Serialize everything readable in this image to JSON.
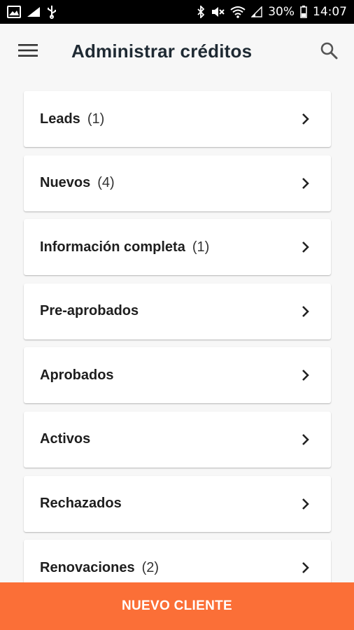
{
  "status_bar": {
    "battery_percent": "30%",
    "time": "14:07",
    "icons": [
      "gallery-icon",
      "signal-icon",
      "usb-icon",
      "bluetooth-icon",
      "mute-icon",
      "wifi-icon",
      "signal-weak-icon",
      "battery-icon"
    ]
  },
  "app_bar": {
    "title": "Administrar créditos",
    "menu_icon": "hamburger-menu-icon",
    "search_icon": "search-icon"
  },
  "list": {
    "items": [
      {
        "label": "Leads",
        "count": "(1)"
      },
      {
        "label": "Nuevos",
        "count": "(4)"
      },
      {
        "label": "Información completa",
        "count": "(1)"
      },
      {
        "label": "Pre-aprobados",
        "count": ""
      },
      {
        "label": "Aprobados",
        "count": ""
      },
      {
        "label": "Activos",
        "count": ""
      },
      {
        "label": "Rechazados",
        "count": ""
      },
      {
        "label": "Renovaciones",
        "count": "(2)"
      }
    ]
  },
  "bottom_button": {
    "label": "NUEVO CLIENTE"
  },
  "colors": {
    "accent": "#fb6f37",
    "background": "#f7f7f7",
    "card": "#ffffff",
    "title": "#1f2a33"
  }
}
